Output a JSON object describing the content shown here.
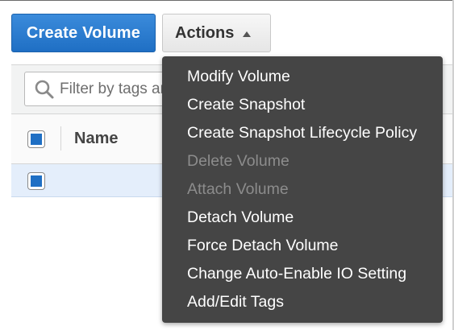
{
  "toolbar": {
    "create_volume_label": "Create Volume",
    "actions_label": "Actions"
  },
  "filter": {
    "placeholder": "Filter by tags and attributes or search by keyword"
  },
  "table": {
    "columns": [
      "Name"
    ],
    "rows": [
      {
        "name": "",
        "selected": true
      }
    ]
  },
  "actions_menu": {
    "items": [
      {
        "label": "Modify Volume",
        "enabled": true
      },
      {
        "label": "Create Snapshot",
        "enabled": true
      },
      {
        "label": "Create Snapshot Lifecycle Policy",
        "enabled": true
      },
      {
        "label": "Delete Volume",
        "enabled": false
      },
      {
        "label": "Attach Volume",
        "enabled": false
      },
      {
        "label": "Detach Volume",
        "enabled": true
      },
      {
        "label": "Force Detach Volume",
        "enabled": true
      },
      {
        "label": "Change Auto-Enable IO Setting",
        "enabled": true
      },
      {
        "label": "Add/Edit Tags",
        "enabled": true
      }
    ]
  },
  "icons": {
    "search": "search-icon",
    "actions_chevron": "chevron-up-icon"
  },
  "colors": {
    "primary_button": "#1f6fc4",
    "menu_background": "#454545",
    "menu_text": "#ffffff",
    "menu_disabled_text": "#8c8c8c",
    "selected_row": "#e4eefb"
  }
}
